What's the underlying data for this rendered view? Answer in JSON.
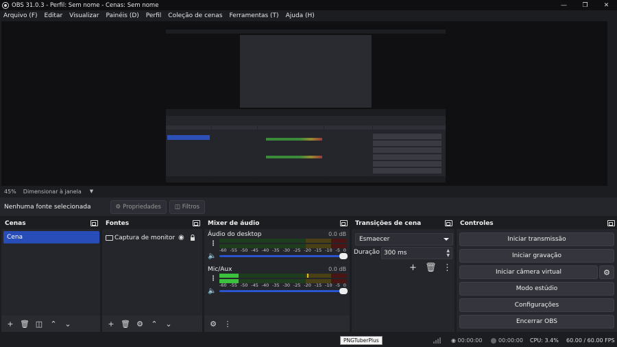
{
  "window": {
    "title": "OBS 31.0.3 - Perfil: Sem nome - Cenas: Sem nome"
  },
  "menu": [
    "Arquivo (F)",
    "Editar",
    "Visualizar",
    "Painéis (D)",
    "Perfil",
    "Coleção de cenas",
    "Ferramentas (T)",
    "Ajuda (H)"
  ],
  "zoom": {
    "value": "45%",
    "mode": "Dimensionar à janela"
  },
  "source_toolbar": {
    "none_selected": "Nenhuma fonte selecionada",
    "properties": "Propriedades",
    "filters": "Filtros"
  },
  "scenes": {
    "title": "Cenas",
    "items": [
      "Cena"
    ]
  },
  "sources": {
    "title": "Fontes",
    "items": [
      "Captura de monitor"
    ]
  },
  "mixer": {
    "title": "Mixer de áudio",
    "channels": [
      {
        "name": "Áudio do desktop",
        "db": "0.0 dB",
        "level": 0.0
      },
      {
        "name": "Mic/Aux",
        "db": "0.0 dB",
        "level": 0.15
      }
    ],
    "ticks": [
      "-60",
      "-55",
      "-50",
      "-45",
      "-40",
      "-35",
      "-30",
      "-25",
      "-20",
      "-15",
      "-10",
      "-5",
      "0"
    ]
  },
  "transitions": {
    "title": "Transições de cena",
    "selected": "Esmaecer",
    "duration_label": "Duração",
    "duration_value": "300 ms"
  },
  "controls": {
    "title": "Controles",
    "buttons": [
      "Iniciar transmissão",
      "Iniciar gravação",
      "Iniciar câmera virtual",
      "Modo estúdio",
      "Configurações",
      "Encerrar OBS"
    ]
  },
  "status": {
    "tooltip": "PNGTuberPlus",
    "stream_time": "00:00:00",
    "rec_time": "00:00:00",
    "cpu": "CPU: 3.4%",
    "fps": "60.00 / 60.00 FPS"
  }
}
